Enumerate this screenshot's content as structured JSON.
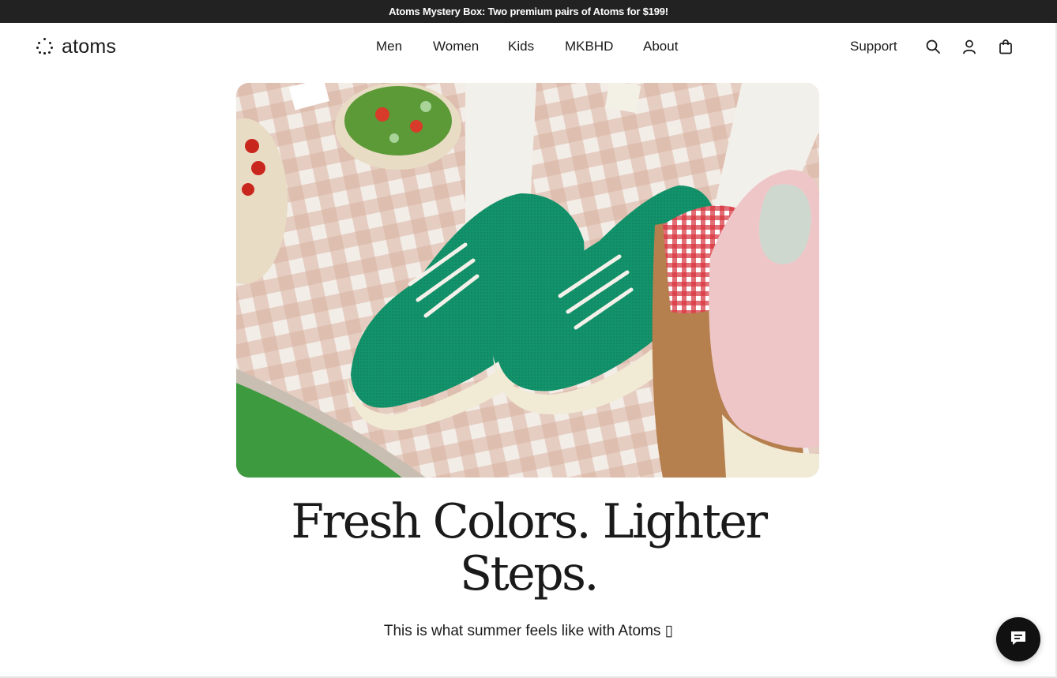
{
  "announcement": {
    "text": "Atoms Mystery Box: Two premium pairs of Atoms for $199!"
  },
  "header": {
    "logo_text": "atoms",
    "nav": [
      {
        "label": "Men"
      },
      {
        "label": "Women"
      },
      {
        "label": "Kids"
      },
      {
        "label": "MKBHD"
      },
      {
        "label": "About"
      }
    ],
    "support_label": "Support",
    "icons": [
      "search-icon",
      "account-icon",
      "cart-bag-icon"
    ]
  },
  "hero": {
    "image_subject": "green-and-pink-sneakers-picnic-photo",
    "headline": "Fresh Colors. Lighter Steps.",
    "subline": "This is what summer feels like with Atoms ▯"
  },
  "chat": {
    "icon": "chat-bubble-icon"
  },
  "colors": {
    "announcement_bg": "#222222",
    "text": "#1a1a1a",
    "chat_button": "#111111",
    "shoe_green": "#13936b",
    "shoe_pink": "#efc6c8"
  }
}
